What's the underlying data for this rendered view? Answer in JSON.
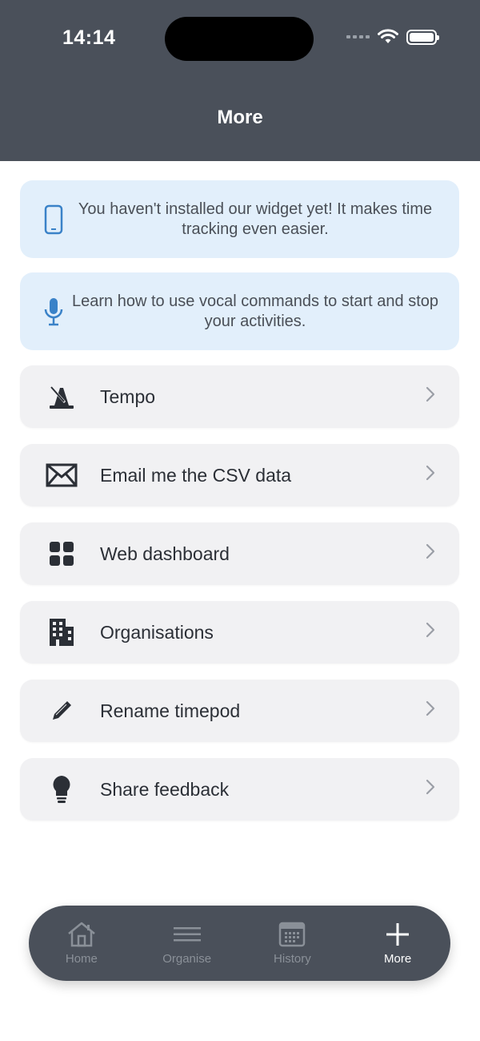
{
  "status_bar": {
    "time": "14:14"
  },
  "header": {
    "title": "More"
  },
  "banners": [
    {
      "icon": "phone-icon",
      "text": "You haven't installed our widget yet! It makes time tracking even easier."
    },
    {
      "icon": "microphone-icon",
      "text": "Learn how to use vocal commands to start and stop your activities."
    }
  ],
  "menu": {
    "items": [
      {
        "icon": "metronome-icon",
        "label": "Tempo"
      },
      {
        "icon": "envelope-icon",
        "label": "Email me the CSV data"
      },
      {
        "icon": "grid-icon",
        "label": "Web dashboard"
      },
      {
        "icon": "building-icon",
        "label": "Organisations"
      },
      {
        "icon": "pencil-icon",
        "label": "Rename timepod"
      },
      {
        "icon": "lightbulb-icon",
        "label": "Share feedback"
      }
    ]
  },
  "tabbar": {
    "tabs": [
      {
        "icon": "home-icon",
        "label": "Home"
      },
      {
        "icon": "menu-lines-icon",
        "label": "Organise"
      },
      {
        "icon": "calendar-icon",
        "label": "History"
      },
      {
        "icon": "plus-icon",
        "label": "More",
        "active": true
      }
    ]
  },
  "colors": {
    "header_bg": "#4a505a",
    "banner_bg": "#e2effb",
    "accent_blue": "#3a82c8",
    "row_bg": "#f1f1f3"
  }
}
